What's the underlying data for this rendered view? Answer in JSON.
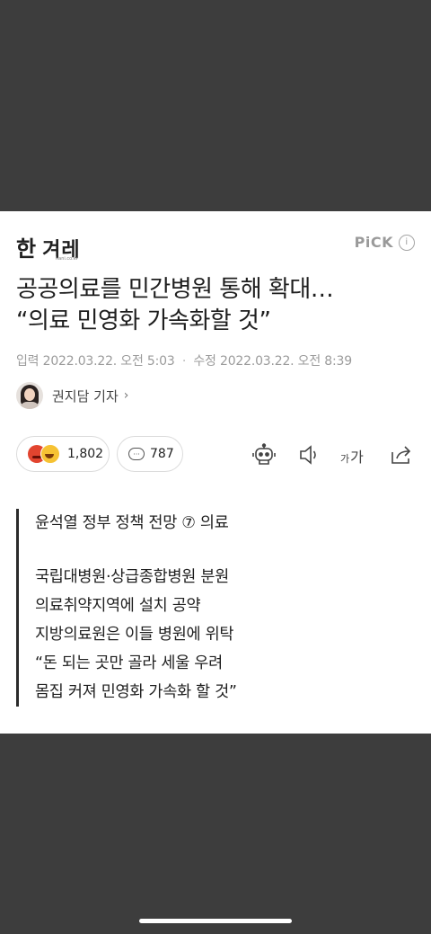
{
  "header": {
    "logo_main": "한겨레",
    "logo_han": "한",
    "logo_rest": "겨레",
    "logo_domain": "hani.co.kr",
    "pick_label": "PiCK",
    "info_glyph": "i"
  },
  "article": {
    "title_line1": "공공의료를 민간병원 통해 확대…",
    "title_line2": "“의료 민영화 가속화할 것”",
    "input_label": "입력",
    "input_date": "2022.03.22. 오전 5:03",
    "separator": "·",
    "edit_label": "수정",
    "edit_date": "2022.03.22. 오전 8:39",
    "author": "권지담 기자",
    "author_chevron": "›"
  },
  "actions": {
    "reaction_count": "1,802",
    "comment_count": "787",
    "font_small": "가",
    "font_large": "가"
  },
  "summary": {
    "line1": "윤석열 정부 정책 전망 ⑦ 의료",
    "line2": "국립대병원·상급종합병원 분원",
    "line3": "의료취약지역에 설치 공약",
    "line4": "지방의료원은 이들 병원에 위탁",
    "line5": "“돈 되는 곳만 골라 세울 우려",
    "line6": "몸집 커져 민영화 가속화 할 것”"
  },
  "colors": {
    "backdrop": "#3d3d3d",
    "sheet": "#ffffff",
    "text": "#1e1e1e",
    "muted": "#9b9b9b"
  },
  "icons": [
    "angry-emoji-icon",
    "laugh-emoji-icon",
    "comment-icon",
    "robot-summary-icon",
    "speaker-icon",
    "font-size-icon",
    "share-icon",
    "info-icon",
    "chevron-right-icon"
  ]
}
